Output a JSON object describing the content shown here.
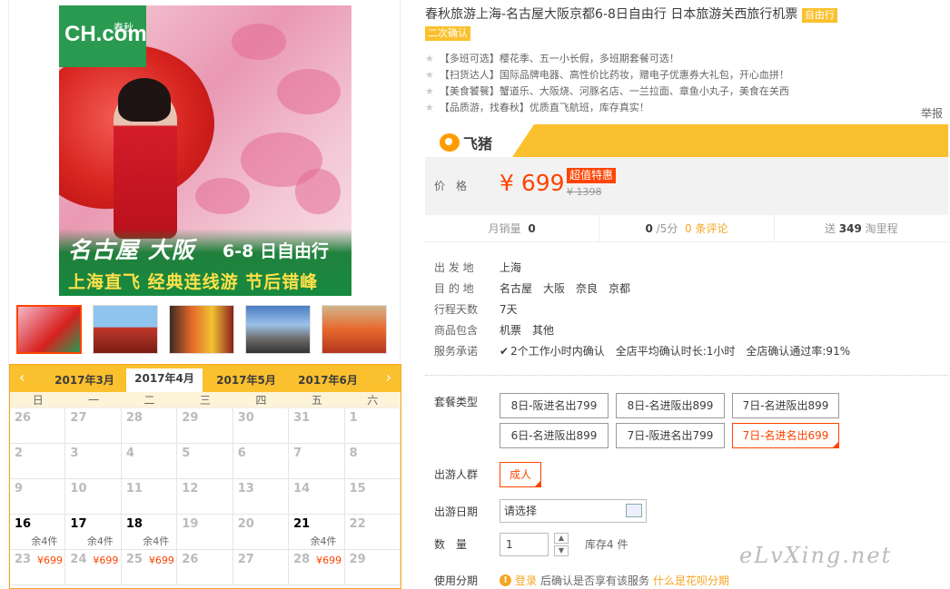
{
  "product": {
    "image": {
      "logo_text": "CH.com",
      "logo_sub": "春秋",
      "headline": "名古屋 大阪",
      "headline_days": "6-8 日自由行",
      "subline": "上海直飞 经典连线游 节后错峰"
    },
    "thumbnails": [
      "thumb-1",
      "thumb-2",
      "thumb-3",
      "thumb-4",
      "thumb-5"
    ],
    "title": "春秋旅游上海-名古屋大阪京都6-8日自由行 日本旅游关西旅行机票",
    "tag_free": "自由行",
    "tag_confirm": "二次确认",
    "features": [
      "【多班可选】樱花季、五一小长假，多班期套餐可选！",
      "【扫货达人】国际品牌电器、高性价比药妆，赠电子优惠券大礼包，开心血拼！",
      "【美食饕餮】蟹道乐、大阪烧、河豚名店、一兰拉面、章鱼小丸子，美食在关西",
      "【品质游，找春秋】优质直飞航班，库存真实！"
    ],
    "report": "举报",
    "platform": "飞猪",
    "price_label": "价格",
    "price": "¥ 699",
    "deal_tag": "超值特惠",
    "original_price": "¥ 1398",
    "stats": {
      "monthly_sales_label": "月销量",
      "monthly_sales": "0",
      "rating": "0",
      "rating_suffix": "/5分",
      "reviews": "0 条评论",
      "points_prefix": "送",
      "points": "349",
      "points_suffix": "淘里程"
    },
    "info": {
      "departure_label": "出 发 地",
      "departure": "上海",
      "destination_label": "目 的 地",
      "destinations": [
        "名古屋",
        "大阪",
        "奈良",
        "京都"
      ],
      "days_label": "行程天数",
      "days": "7天",
      "includes_label": "商品包含",
      "includes": [
        "机票",
        "其他"
      ],
      "service_label": "服务承诺",
      "services": [
        "2个工作小时内确认",
        "全店平均确认时长:1小时",
        "全店确认通过率:91%"
      ]
    },
    "package": {
      "label": "套餐类型",
      "options": [
        "8日-阪进名出799",
        "8日-名进阪出899",
        "7日-名进阪出899",
        "6日-名进阪出899",
        "7日-阪进名出799",
        "7日-名进名出699"
      ],
      "selected": "7日-名进名出699"
    },
    "travelers_label": "出游人群",
    "traveler_option": "成人",
    "date_label": "出游日期",
    "date_placeholder": "请选择",
    "quantity_label": "数　量",
    "quantity": "1",
    "stock": "库存4 件",
    "installment_label": "使用分期",
    "installment_login": "登录",
    "installment_text": "后确认是否享有该服务",
    "installment_link": "什么是花呗分期"
  },
  "calendar": {
    "months": [
      "2017年3月",
      "2017年4月",
      "2017年5月",
      "2017年6月"
    ],
    "active_month": "2017年4月",
    "weekdays": [
      "日",
      "一",
      "二",
      "三",
      "四",
      "五",
      "六"
    ],
    "cells": [
      {
        "d": "26"
      },
      {
        "d": "27"
      },
      {
        "d": "28"
      },
      {
        "d": "29"
      },
      {
        "d": "30"
      },
      {
        "d": "31"
      },
      {
        "d": "1"
      },
      {
        "d": "2"
      },
      {
        "d": "3"
      },
      {
        "d": "4"
      },
      {
        "d": "5"
      },
      {
        "d": "6"
      },
      {
        "d": "7"
      },
      {
        "d": "8"
      },
      {
        "d": "9"
      },
      {
        "d": "10"
      },
      {
        "d": "11"
      },
      {
        "d": "12"
      },
      {
        "d": "13"
      },
      {
        "d": "14"
      },
      {
        "d": "15"
      },
      {
        "d": "16",
        "s": "余4件",
        "on": true
      },
      {
        "d": "17",
        "s": "余4件",
        "on": true
      },
      {
        "d": "18",
        "s": "余4件",
        "on": true
      },
      {
        "d": "19"
      },
      {
        "d": "20"
      },
      {
        "d": "21",
        "s": "余4件",
        "on": true
      },
      {
        "d": "22"
      },
      {
        "d": "23",
        "p": "¥699"
      },
      {
        "d": "24",
        "p": "¥699"
      },
      {
        "d": "25",
        "p": "¥699"
      },
      {
        "d": "26"
      },
      {
        "d": "27"
      },
      {
        "d": "28",
        "p": "¥699"
      },
      {
        "d": "29"
      }
    ]
  },
  "watermark": "eLvXing.net",
  "colors": {
    "accent": "#ff4400",
    "yellow": "#fbc02d",
    "green": "#168a3f",
    "orange": "#f5a623"
  }
}
